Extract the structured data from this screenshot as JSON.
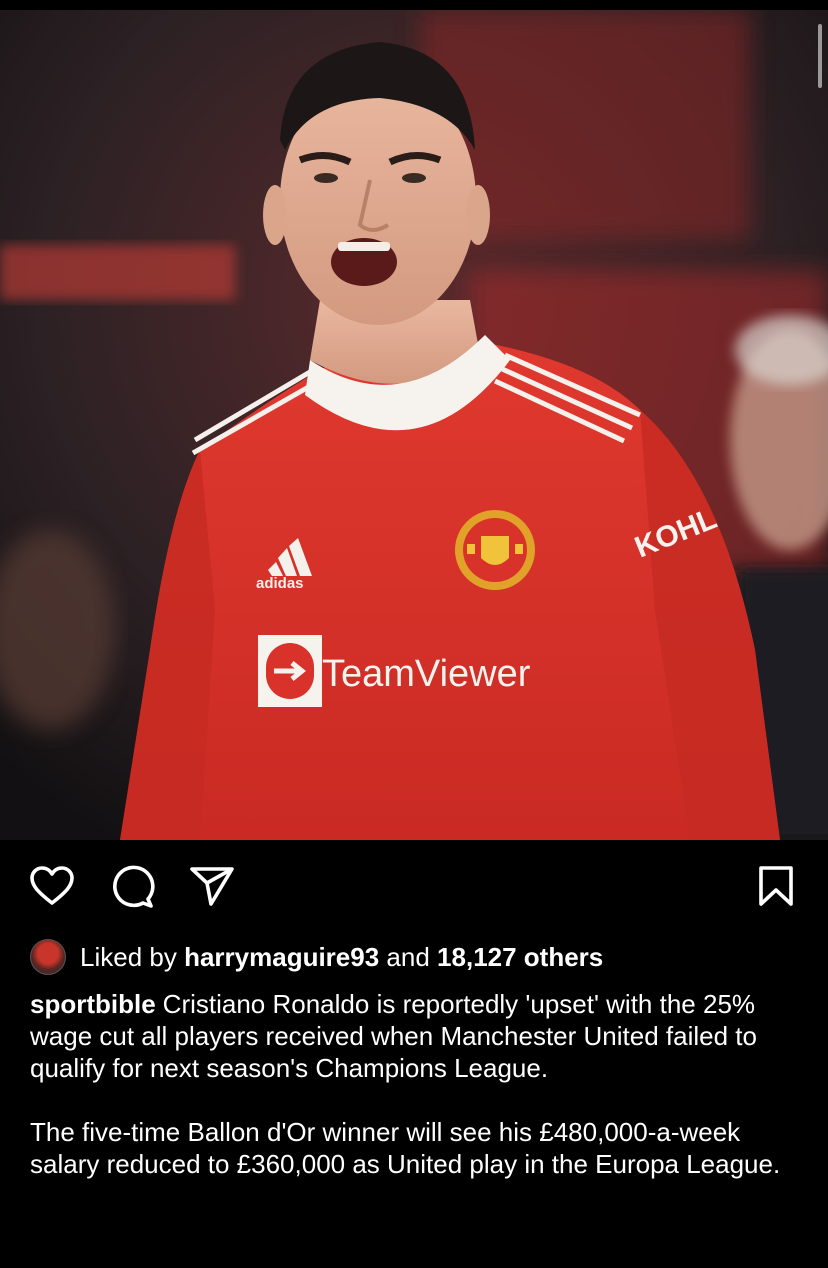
{
  "post": {
    "photo_icon": "photo",
    "jersey_texts": {
      "brand": "adidas",
      "sponsor": "TeamViewer",
      "sleeve": "KOHL"
    }
  },
  "actions": {
    "like_icon": "heart-icon",
    "comment_icon": "comment-icon",
    "share_icon": "send-icon",
    "save_icon": "bookmark-icon"
  },
  "likes": {
    "prefix": "Liked by",
    "user": "harrymaguire93",
    "connector": "and",
    "others": "18,127 others"
  },
  "caption": {
    "username": "sportbible",
    "paragraph1": "Cristiano Ronaldo is reportedly 'upset' with the 25% wage cut all players received when Manchester United failed to qualify for next season's Champions League.",
    "paragraph2": "The five-time Ballon d'Or winner will see his £480,000-a-week salary reduced to £360,000 as United play in the Europa League."
  },
  "colors": {
    "background": "#000000",
    "text": "#ffffff",
    "jersey_red": "#d8322b"
  }
}
